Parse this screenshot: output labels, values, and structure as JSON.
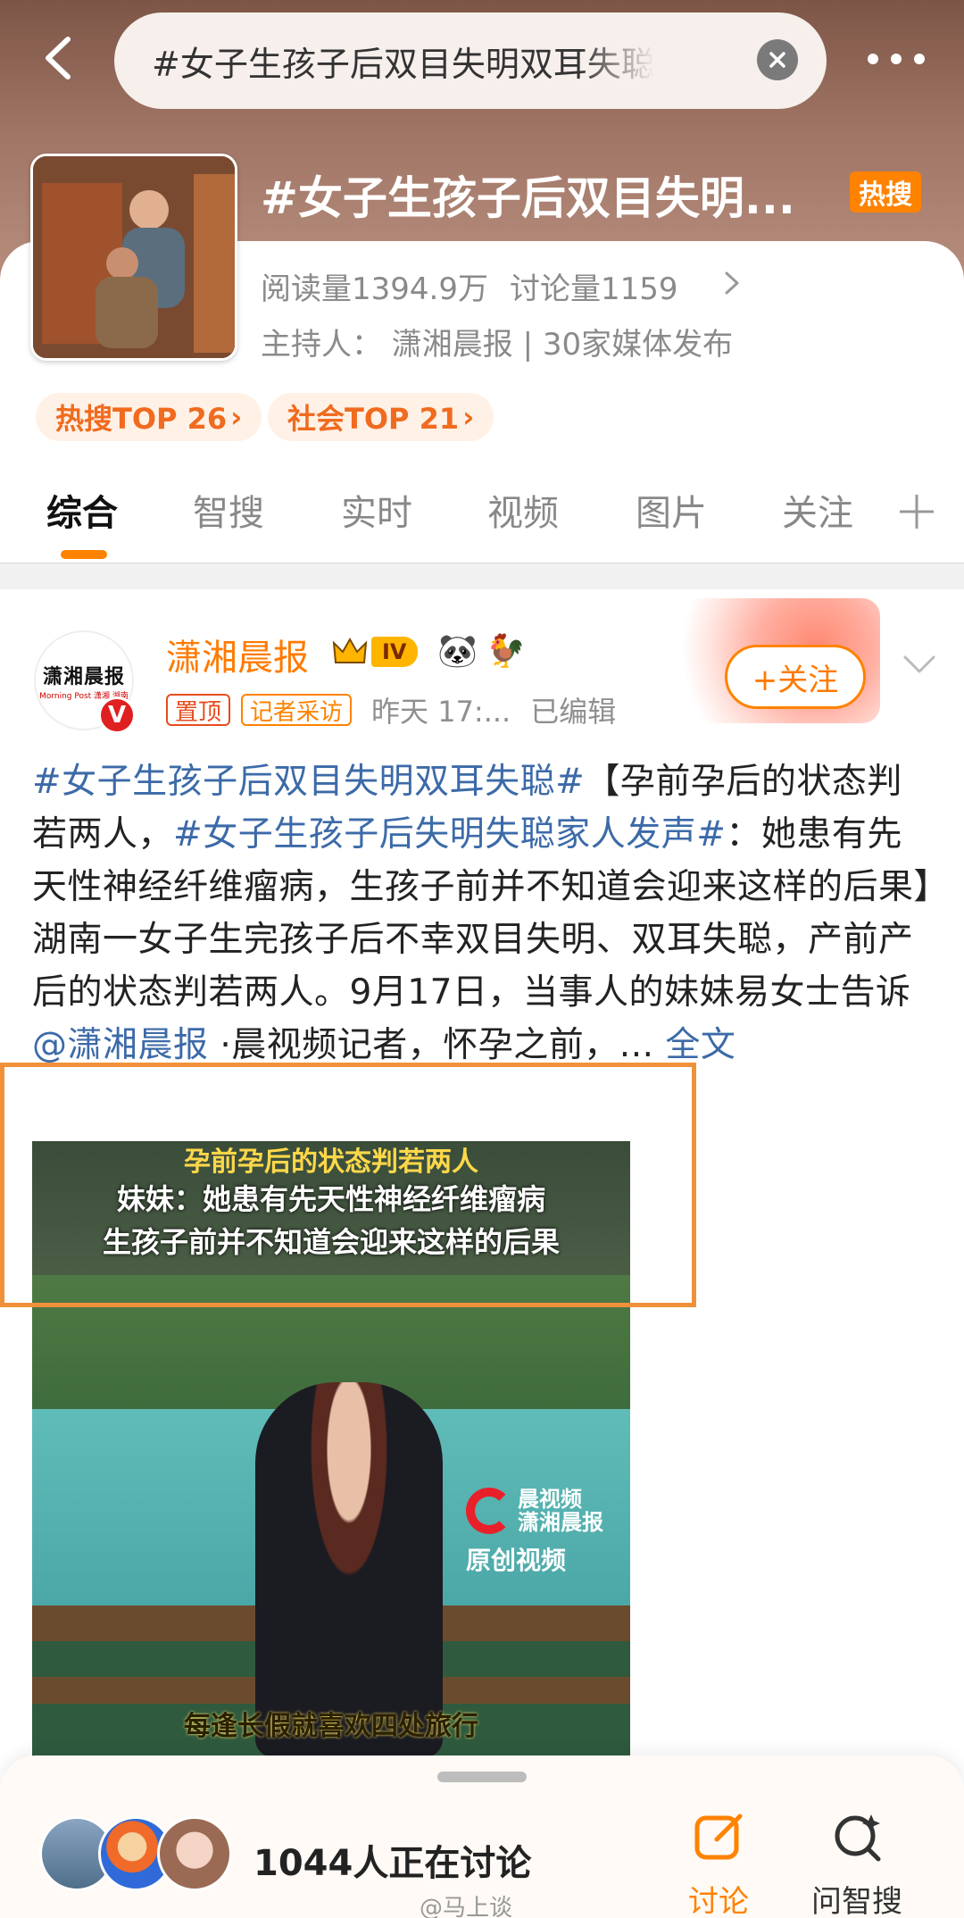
{
  "search": {
    "query": "#女子生孩子后双目失明双耳失聪"
  },
  "topic": {
    "title": "#女子生孩子后双目失明...",
    "hot_badge": "热搜",
    "reads": "阅读量1394.9万",
    "discussions": "讨论量1159",
    "host": "主持人：  潇湘晨报 | 30家媒体发布",
    "ranks": [
      {
        "label": "热搜TOP 26",
        "arrow": "›"
      },
      {
        "label": "社会TOP 21",
        "arrow": "›"
      }
    ]
  },
  "tabs": [
    "综合",
    "智搜",
    "实时",
    "视频",
    "图片",
    "关注"
  ],
  "tab_add": "+",
  "post": {
    "avatar_text": "潇湘晨报",
    "avatar_sub": "Morning Post 潇湘 湖南",
    "verified": "V",
    "author": "潇湘晨报",
    "vip_level": "IV",
    "emoji_1": "🐼",
    "emoji_2": "🐓",
    "tag_pinned": "置顶",
    "tag_reporter": "记者采访",
    "time": "昨天 17:...",
    "edited": "已编辑",
    "follow": "+关注",
    "body": {
      "hashtag_1": "#女子生孩子后双目失明双耳失聪#",
      "text_1": "【孕前孕后的状态判若两人，",
      "hashtag_2": "#女子生孩子后失明失聪家人发声#",
      "text_2": "：她患有先天性神经纤维瘤病，生孩子前并不知道会迎来这样的后果】湖南一女子生完孩子后不幸双目失明、双耳失聪，产前产后的状态判若两人。9月17日，当事人的妹妹易女士告诉",
      "mention": "@潇湘晨报",
      "text_3": " ·晨视频记者，怀孕之前，... ",
      "fulltext": "全文"
    },
    "video": {
      "caption_1": "孕前孕后的状态判若两人",
      "caption_2": "妹妹：她患有先天性神经纤维瘤病",
      "caption_3": "生孩子前并不知道会迎来这样的后果",
      "caption_bottom": "每逢长假就喜欢四处旅行",
      "brand_1": "晨视频",
      "brand_2": "潇湘晨报",
      "brand_orig": "原创视频"
    }
  },
  "bottom": {
    "discussing": "1044人正在讨论",
    "nav_discuss": "讨论",
    "nav_ask": "问智搜",
    "watermark": "@马上谈"
  },
  "colors": {
    "accent": "#ff8200",
    "link": "#3c6aa8",
    "highlight": "#f0913a"
  }
}
